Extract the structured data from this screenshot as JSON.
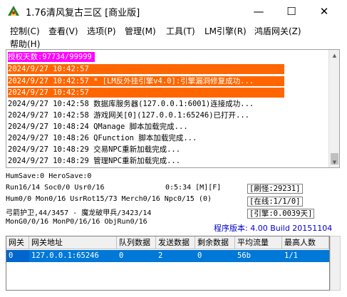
{
  "window": {
    "title": "1.76清风复古三区 [商业版]",
    "min_glyph": "—",
    "max_glyph": "☐",
    "close_glyph": "✕"
  },
  "menu": {
    "items": [
      "控制(C)",
      "查看(V)",
      "选项(P)",
      "管理(M)",
      "工具(T)",
      "LM引擎(R)",
      "鸿盾网关(Z)",
      "帮助(H)"
    ]
  },
  "log": {
    "license": "授权天数:97734/99999",
    "warn_lines": [
      "2024/9/27 10:42:57",
      "2024/9/27 10:42:57 * [LM反外挂引擎v4.0]:引擎漏洞修复成功...",
      "2024/9/27 10:42:57"
    ],
    "lines": [
      "2024/9/27 10:42:58 数据库服务器(127.0.0.1:6001)连接成功...",
      "2024/9/27 10:42:58 游戏网关[0](127.0.0.1:65246)已打开...",
      "2024/9/27 10:48:24 QManage 脚本加载完成...",
      "2024/9/27 10:48:26 QFunction 脚本加载完成...",
      "2024/9/27 10:48:29 交易NPC重新加载完成...",
      "2024/9/27 10:48:29 管理NPC重新加载完成..."
    ]
  },
  "status": {
    "save": "HumSave:0 HeroSave:0",
    "run": "Run16/14 Soc0/0 Usr0/16",
    "uptime": "0:5:34 [M][F]",
    "hum": "Hum0/0 Mon0/16 UsrRot15/73 Merch0/16 Npc0/15 (0)",
    "boss": "弓箭护卫,44/3457 - 魔龙破甲兵/3423/14",
    "mon": "MonG0/0/16 MonP0/16/16 ObjRun0/16",
    "refresh": "[刷怪:29231]",
    "online": "[在线:1/1/0]",
    "engine": "[引擎:0.0039天]",
    "version": "程序版本: 4.00 Build 20151104"
  },
  "gateway_table": {
    "columns": [
      "网关",
      "网关地址",
      "队列数据",
      "发送数据",
      "剩余数据",
      "平均流量",
      "最高人数"
    ],
    "rows": [
      [
        "0",
        "127.0.0.1:65246",
        "0",
        "2",
        "0",
        "56b",
        "1/1"
      ]
    ]
  },
  "colors": {
    "license_bg": "#ff00ff",
    "warn_bg": "#ff6600",
    "selection": "#0078d7",
    "version_text": "#0000cc"
  }
}
